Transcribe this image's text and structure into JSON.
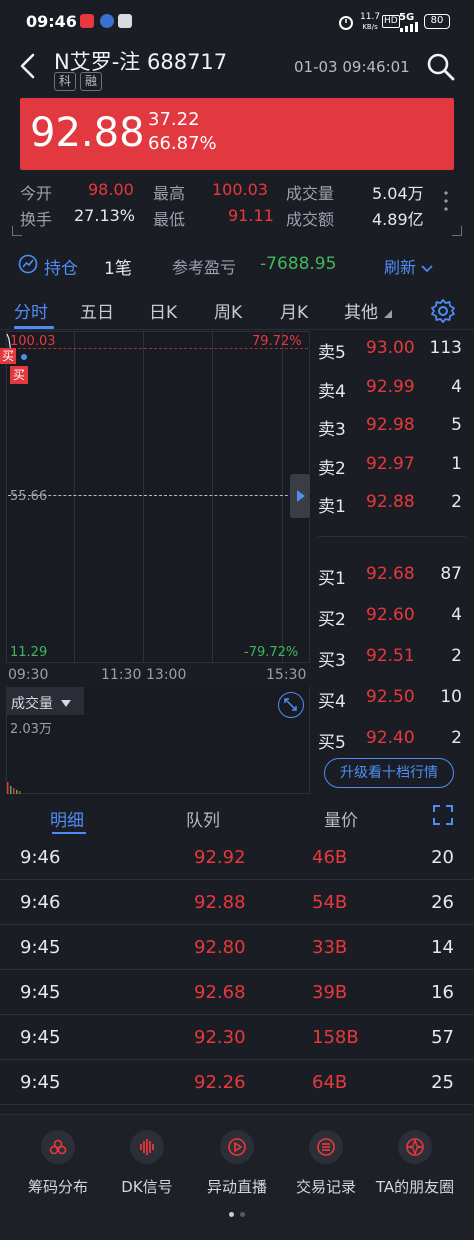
{
  "status_bar": {
    "time": "09:46",
    "net_speed": "11.7",
    "net_unit": "KB/s",
    "hd": "HD",
    "signal": "5G",
    "battery": "80"
  },
  "header": {
    "stock_name": "N艾罗-注",
    "stock_code": "688717",
    "tags": [
      "科",
      "融"
    ],
    "datetime": "01-03 09:46:01"
  },
  "quote": {
    "price": "92.88",
    "change": "37.22",
    "change_pct": "66.87%"
  },
  "stats": [
    {
      "label": "今开",
      "value": "98.00"
    },
    {
      "label": "最高",
      "value": "100.03"
    },
    {
      "label": "成交量",
      "value": "5.04万"
    },
    {
      "label": "换手",
      "value": "27.13%"
    },
    {
      "label": "最低",
      "value": "91.11"
    },
    {
      "label": "成交额",
      "value": "4.89亿"
    }
  ],
  "holdings": {
    "label": "持仓",
    "count": "1笔",
    "pnl_label": "参考盈亏",
    "pnl_value": "-7688.95",
    "refresh": "刷新"
  },
  "chart_tabs": [
    "分时",
    "五日",
    "日K",
    "周K",
    "月K",
    "其他"
  ],
  "chart": {
    "top_price": "100.03",
    "top_pct": "79.72%",
    "mid_price": "55.66",
    "bottom_price": "11.29",
    "bottom_pct": "-79.72%",
    "times": [
      "09:30",
      "11:30",
      "13:00",
      "15:30"
    ],
    "markers": [
      "买",
      "买"
    ],
    "volume_label": "成交量",
    "volume_value": "2.03万"
  },
  "order_book": {
    "sell": [
      {
        "label": "卖5",
        "price": "93.00",
        "qty": "113"
      },
      {
        "label": "卖4",
        "price": "92.99",
        "qty": "4"
      },
      {
        "label": "卖3",
        "price": "92.98",
        "qty": "5"
      },
      {
        "label": "卖2",
        "price": "92.97",
        "qty": "1"
      },
      {
        "label": "卖1",
        "price": "92.88",
        "qty": "2"
      }
    ],
    "buy": [
      {
        "label": "买1",
        "price": "92.68",
        "qty": "87"
      },
      {
        "label": "买2",
        "price": "92.60",
        "qty": "4"
      },
      {
        "label": "买3",
        "price": "92.51",
        "qty": "2"
      },
      {
        "label": "买4",
        "price": "92.50",
        "qty": "10"
      },
      {
        "label": "买5",
        "price": "92.40",
        "qty": "2"
      }
    ],
    "upgrade": "升级看十档行情"
  },
  "detail_tabs": [
    "明细",
    "队列",
    "量价"
  ],
  "trades": [
    {
      "time": "9:46",
      "price": "92.92",
      "vol": "46B",
      "count": "20"
    },
    {
      "time": "9:46",
      "price": "92.88",
      "vol": "54B",
      "count": "26"
    },
    {
      "time": "9:45",
      "price": "92.80",
      "vol": "33B",
      "count": "14"
    },
    {
      "time": "9:45",
      "price": "92.68",
      "vol": "39B",
      "count": "16"
    },
    {
      "time": "9:45",
      "price": "92.30",
      "vol": "158B",
      "count": "57"
    },
    {
      "time": "9:45",
      "price": "92.26",
      "vol": "64B",
      "count": "25"
    }
  ],
  "bottom_nav": [
    {
      "label": "筹码分布",
      "icon": "chips-icon"
    },
    {
      "label": "DK信号",
      "icon": "signal-wave-icon"
    },
    {
      "label": "异动直播",
      "icon": "play-icon"
    },
    {
      "label": "交易记录",
      "icon": "list-icon"
    },
    {
      "label": "TA的朋友圈",
      "icon": "friends-icon"
    }
  ],
  "colors": {
    "up": "#e8383d",
    "down": "#3fb85c",
    "accent": "#4e8df5",
    "bg": "#1b1d24"
  }
}
